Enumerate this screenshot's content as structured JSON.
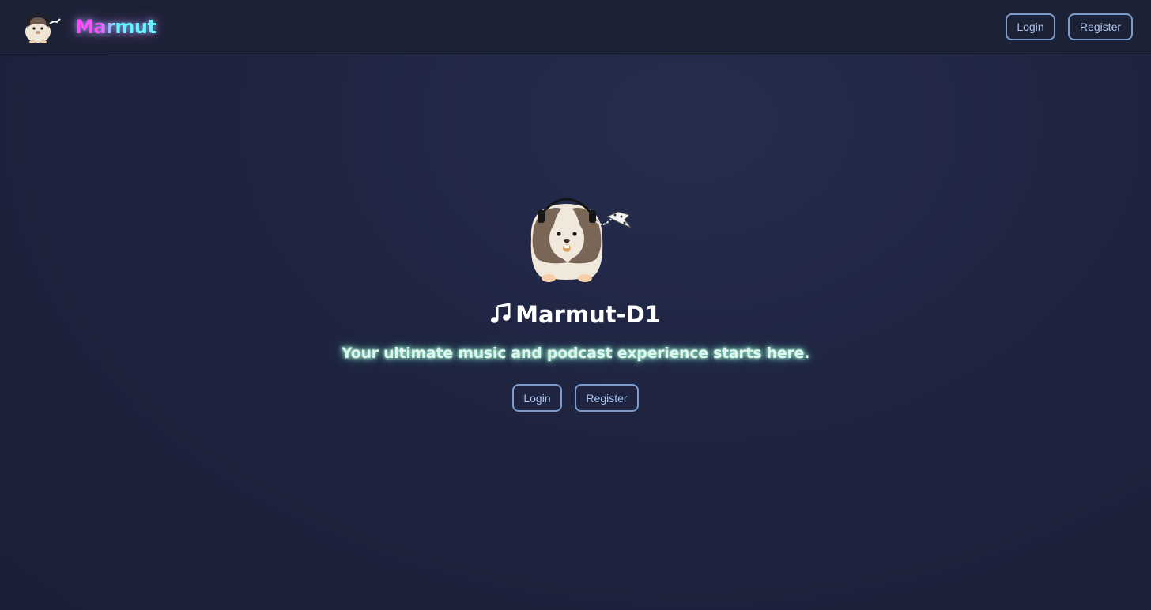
{
  "navbar": {
    "logo_icon": "guinea-pig-logo-icon",
    "brand": "Marmut",
    "login_label": "Login",
    "register_label": "Register"
  },
  "hero": {
    "mascot_icon": "guinea-pig-headphones-icon",
    "note_icon": "music-note-icon",
    "title": "Marmut-D1",
    "tagline": "Your ultimate music and podcast experience starts here.",
    "login_label": "Login",
    "register_label": "Register"
  },
  "colors": {
    "background": "#1f2541",
    "navbar": "#1c2236",
    "button_border": "#7a9cd0",
    "button_text": "#a9c4ee",
    "brand_pink": "#ff4dff",
    "brand_cyan": "#66f2ff",
    "tagline_glow": "#9fe8cf"
  }
}
